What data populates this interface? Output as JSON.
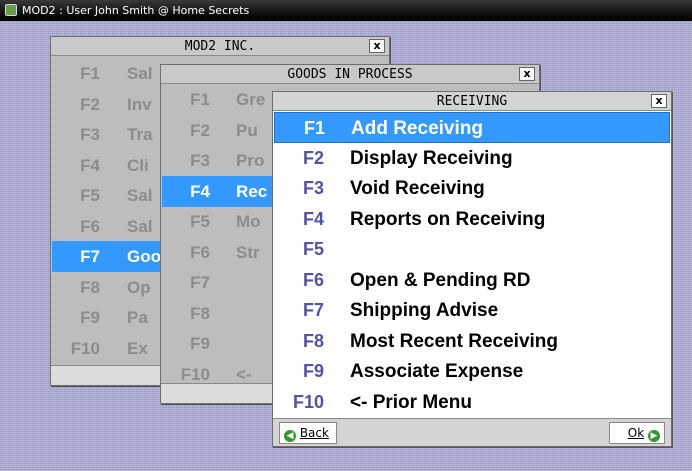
{
  "os": {
    "title": "MOD2 : User John Smith @ Home Secrets"
  },
  "mod2": {
    "title": "MOD2 INC.",
    "close": "x",
    "items": [
      {
        "key": "F1",
        "label": "Sal"
      },
      {
        "key": "F2",
        "label": "Inv"
      },
      {
        "key": "F3",
        "label": "Tra"
      },
      {
        "key": "F4",
        "label": "Cli"
      },
      {
        "key": "F5",
        "label": "Sal"
      },
      {
        "key": "F6",
        "label": "Sal"
      },
      {
        "key": "F7",
        "label": "Goo"
      },
      {
        "key": "F8",
        "label": "Op"
      },
      {
        "key": "F9",
        "label": "Pa"
      },
      {
        "key": "F10",
        "label": "Ex"
      }
    ],
    "selected_index": 6
  },
  "goods": {
    "title": "GOODS IN PROCESS",
    "close": "x",
    "items": [
      {
        "key": "F1",
        "label": "Gre"
      },
      {
        "key": "F2",
        "label": "Pu"
      },
      {
        "key": "F3",
        "label": "Pro"
      },
      {
        "key": "F4",
        "label": "Rec"
      },
      {
        "key": "F5",
        "label": "Mo"
      },
      {
        "key": "F6",
        "label": "Str"
      },
      {
        "key": "F7",
        "label": ""
      },
      {
        "key": "F8",
        "label": ""
      },
      {
        "key": "F9",
        "label": ""
      },
      {
        "key": "F10",
        "label": "<-"
      }
    ],
    "selected_index": 3
  },
  "receiving": {
    "title": "RECEIVING",
    "close": "x",
    "items": [
      {
        "key": "F1",
        "label": "Add Receiving"
      },
      {
        "key": "F2",
        "label": "Display Receiving"
      },
      {
        "key": "F3",
        "label": "Void Receiving"
      },
      {
        "key": "F4",
        "label": "Reports on Receiving"
      },
      {
        "key": "F5",
        "label": ""
      },
      {
        "key": "F6",
        "label": "Open & Pending RD"
      },
      {
        "key": "F7",
        "label": "Shipping Advise"
      },
      {
        "key": "F8",
        "label": "Most Recent Receiving"
      },
      {
        "key": "F9",
        "label": "Associate Expense"
      },
      {
        "key": "F10",
        "label": "<- Prior Menu"
      }
    ],
    "selected_index": 0,
    "back_label": "Back",
    "ok_label": "Ok"
  },
  "colors": {
    "highlight": "#3399ff",
    "key_color": "#5252a8",
    "dim_text": "#8c8c8c"
  }
}
